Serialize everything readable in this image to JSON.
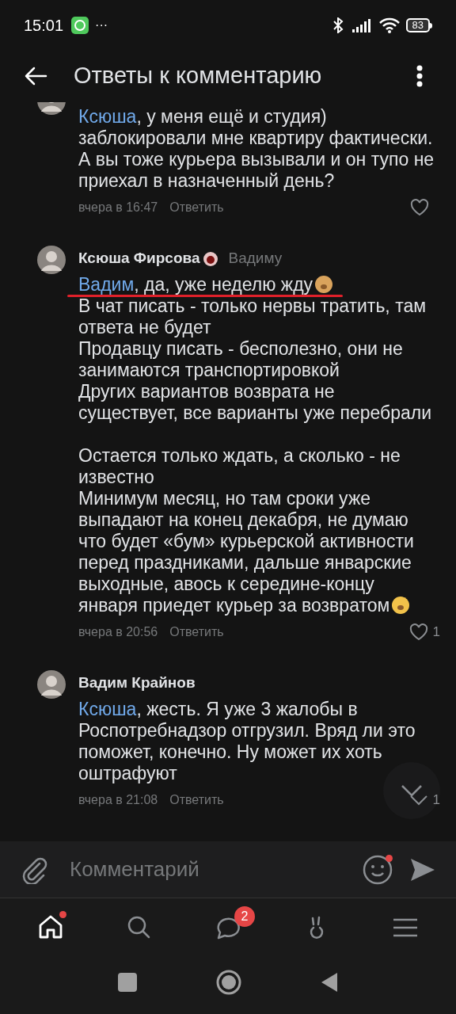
{
  "status_bar": {
    "time": "15:01",
    "more": "···",
    "battery": "83"
  },
  "header": {
    "title": "Ответы к комментарию"
  },
  "comments": [
    {
      "avatar_partial": true,
      "mention": "Ксюша",
      "paragraphs": [
        {
          "kind": "text",
          "text": ", у меня ещё и студия) заблокировали мне квартиру фактически. А вы тоже курьера вызывали и он тупо не приехал в назначенный день?"
        }
      ],
      "time": "вчера в 16:47",
      "reply": "Ответить",
      "reaction": {
        "kind": "heart"
      }
    },
    {
      "author": "Ксюша Фирсова",
      "author_badge": true,
      "reply_to": "Вадиму",
      "mention": "Вадим",
      "paragraphs": [
        {
          "kind": "monkey",
          "text": ", да, уже неделю жду",
          "underlined": true
        },
        {
          "kind": "text",
          "text": "В чат писать - только нервы тратить, там ответа не будет"
        },
        {
          "kind": "text",
          "text": "Продавцу писать - бесполезно, они не занимаются транспортировкой"
        },
        {
          "kind": "text",
          "text": "Других вариантов возврата не существует, все варианты уже перебрали"
        },
        {
          "kind": "spacer"
        },
        {
          "kind": "text",
          "text": "Остается только ждать, а сколько - не известно"
        },
        {
          "kind": "salute",
          "text": "Минимум месяц, но там сроки уже выпадают на конец декабря, не думаю что будет «бум» курьерской активности перед праздниками, дальше январские выходные, авось к середине-концу января приедет курьер за возвратом"
        }
      ],
      "time": "вчера в 20:56",
      "reply": "Ответить",
      "reaction": {
        "kind": "heart",
        "count": "1"
      }
    },
    {
      "author": "Вадим Крайнов",
      "mention": "Ксюша",
      "paragraphs": [
        {
          "kind": "text",
          "text": ", жесть. Я уже 3 жалобы в Роспотребнадзор отгрузил. Вряд ли это поможет, конечно. Ну может их хоть оштрафуют"
        }
      ],
      "time": "вчера в 21:08",
      "reply": "Ответить",
      "reaction": {
        "kind": "chevron",
        "count": "1"
      }
    }
  ],
  "composer": {
    "placeholder": "Комментарий",
    "emoji_dot": true
  },
  "nav": [
    {
      "kind": "home",
      "selected": true,
      "dot": true
    },
    {
      "kind": "search",
      "selected": false
    },
    {
      "kind": "messages",
      "selected": false,
      "badge": "2"
    },
    {
      "kind": "clips",
      "selected": false
    },
    {
      "kind": "menu",
      "selected": false
    }
  ]
}
